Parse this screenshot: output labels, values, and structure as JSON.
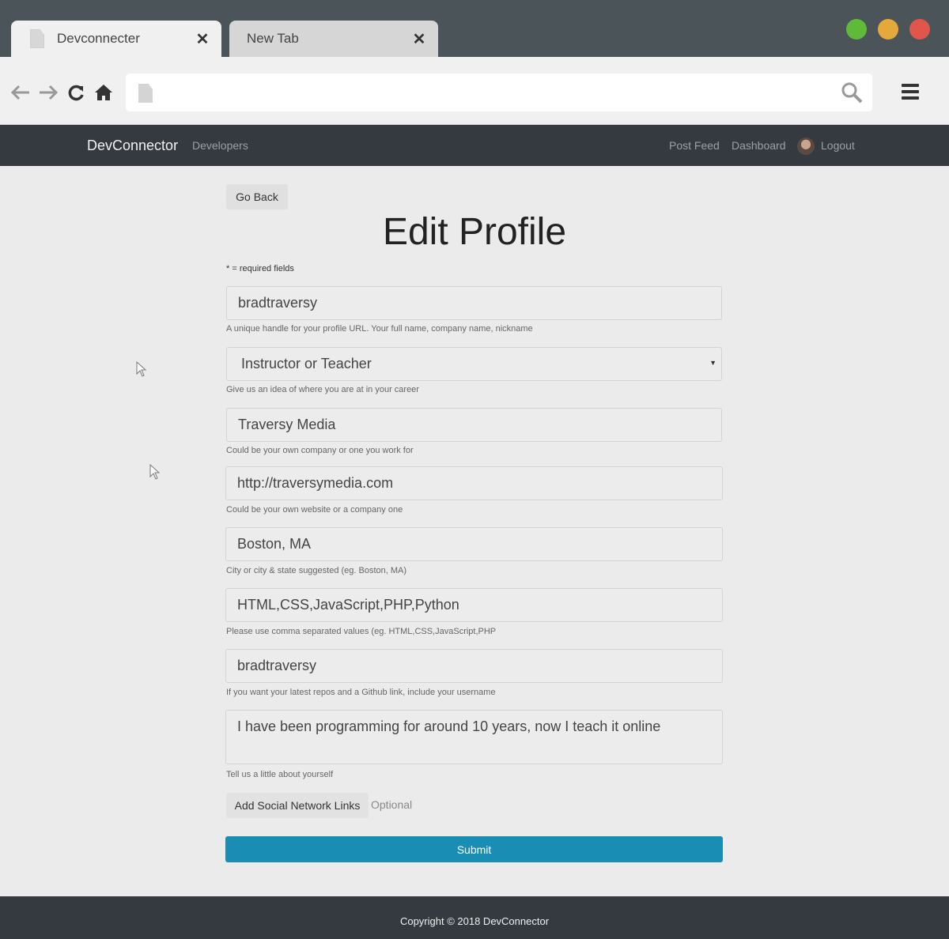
{
  "browser": {
    "tabs": [
      {
        "title": "Devconnecter",
        "close": "✕"
      },
      {
        "title": "New Tab",
        "close": "✕"
      }
    ],
    "url": "",
    "traffic_lights": {
      "green": "#5fba3a",
      "yellow": "#e5a83b",
      "red": "#e0564b"
    }
  },
  "navbar": {
    "brand": "DevConnector",
    "developers": "Developers",
    "post_feed": "Post Feed",
    "dashboard": "Dashboard",
    "logout": "Logout"
  },
  "page": {
    "go_back": "Go Back",
    "title": "Edit Profile",
    "required_note": "* = required fields"
  },
  "form": {
    "handle": {
      "value": "bradtraversy",
      "hint": "A unique handle for your profile URL. Your full name, company name, nickname"
    },
    "status": {
      "value": "Instructor or Teacher",
      "hint": "Give us an idea of where you are at in your career"
    },
    "company": {
      "value": "Traversy Media",
      "hint": "Could be your own company or one you work for"
    },
    "website": {
      "value": "http://traversymedia.com",
      "hint": "Could be your own website or a company one"
    },
    "location": {
      "value": "Boston, MA",
      "hint": "City or city & state suggested (eg. Boston, MA)"
    },
    "skills": {
      "value": "HTML,CSS,JavaScript,PHP,Python",
      "hint": "Please use comma separated values (eg. HTML,CSS,JavaScript,PHP"
    },
    "github": {
      "value": "bradtraversy",
      "hint": "If you want your latest repos and a Github link, include your username"
    },
    "bio": {
      "value": "I have been programming for around 10 years, now I teach it online",
      "hint": "Tell us a little about yourself"
    },
    "social_button": "Add Social Network Links",
    "social_optional": "Optional",
    "submit": "Submit"
  },
  "colors": {
    "navbar": "#343a40",
    "submit": "#1a8db5"
  },
  "footer": {
    "text": "Copyright © 2018 DevConnector"
  }
}
